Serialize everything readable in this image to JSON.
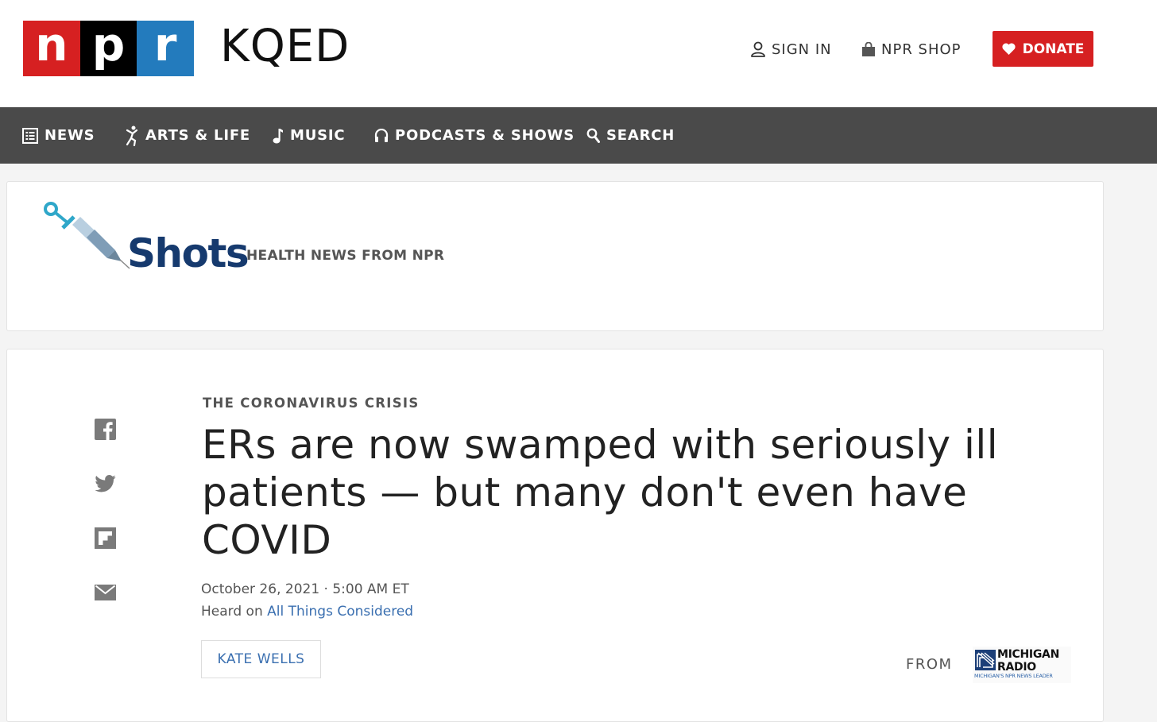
{
  "header": {
    "logo_letters": [
      "n",
      "p",
      "r"
    ],
    "station": "KQED",
    "sign_in": "SIGN IN",
    "shop": "NPR SHOP",
    "donate": "DONATE"
  },
  "nav": {
    "items": [
      {
        "label": "NEWS",
        "icon": "news-icon"
      },
      {
        "label": "ARTS & LIFE",
        "icon": "dancer-icon"
      },
      {
        "label": "MUSIC",
        "icon": "music-note-icon"
      },
      {
        "label": "PODCASTS & SHOWS",
        "icon": "headphones-icon"
      },
      {
        "label": "SEARCH",
        "icon": "search-icon"
      }
    ]
  },
  "section": {
    "name": "Shots",
    "tagline": "HEALTH NEWS FROM NPR"
  },
  "share": [
    "facebook-icon",
    "twitter-icon",
    "flipboard-icon",
    "email-icon"
  ],
  "article": {
    "slug": "THE CORONAVIRUS CRISIS",
    "headline": "ERs are now swamped with seriously ill patients — but many don't even have COVID",
    "date": "October 26, 2021 · 5:00 AM ET",
    "heard_on_prefix": "Heard on",
    "program": "All Things Considered",
    "author": "KATE WELLS",
    "from_label": "FROM",
    "source_name": "MICHIGAN RADIO",
    "source_line1": "MICHIGAN",
    "source_line2": "RADIO",
    "source_tagline": "MICHIGAN'S NPR NEWS LEADER"
  },
  "colors": {
    "npr_red": "#d62021",
    "npr_black": "#000000",
    "npr_blue": "#237bbd",
    "nav_bg": "#4a4a4a",
    "shots_navy": "#163a6e",
    "link_blue": "#3a6fb0"
  }
}
